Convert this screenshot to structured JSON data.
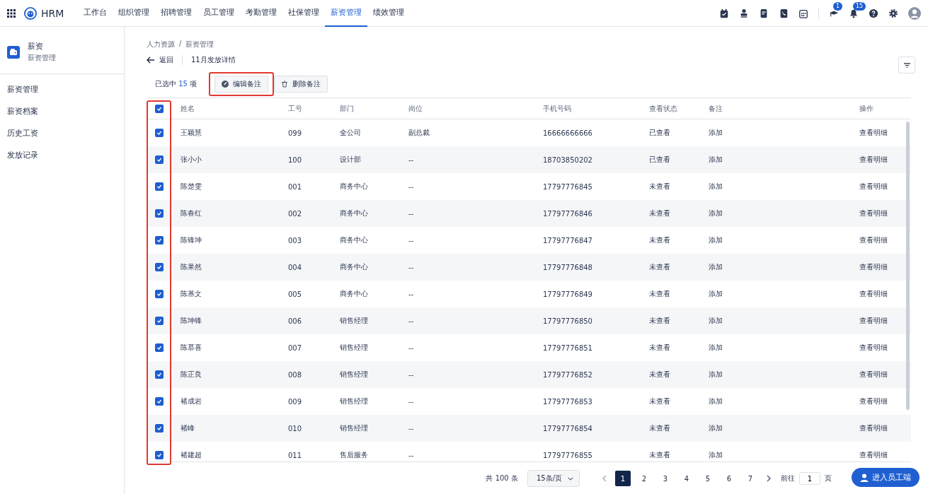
{
  "brand": {
    "name": "HRM"
  },
  "nav": [
    {
      "label": "工作台",
      "selected": false
    },
    {
      "label": "组织管理",
      "selected": false
    },
    {
      "label": "招聘管理",
      "selected": false
    },
    {
      "label": "员工管理",
      "selected": false
    },
    {
      "label": "考勤管理",
      "selected": false
    },
    {
      "label": "社保管理",
      "selected": false
    },
    {
      "label": "薪资管理",
      "selected": true
    },
    {
      "label": "绩效管理",
      "selected": false
    }
  ],
  "toolbar_badges": {
    "flag": "1",
    "bell": "15"
  },
  "sidebar": {
    "title": "薪资",
    "subtitle": "薪资管理",
    "items": [
      {
        "label": "薪资管理",
        "selected": false
      },
      {
        "label": "薪资档案",
        "selected": false
      },
      {
        "label": "历史工资",
        "selected": false
      },
      {
        "label": "发放记录",
        "selected": false
      }
    ]
  },
  "breadcrumb": [
    "人力资源",
    "薪资管理"
  ],
  "breadcrumb_separator": "/",
  "back": "返回",
  "page_title": "11月发放详情",
  "selection": {
    "prefix": "已选中",
    "count": "15",
    "suffix": "项"
  },
  "actions": [
    {
      "label": "编辑备注",
      "kind": "edit",
      "highlighted": true
    },
    {
      "label": "删除备注",
      "kind": "delete",
      "highlighted": false
    }
  ],
  "table": {
    "header_checked": true,
    "checkbox_column_highlighted": true,
    "columns": [
      "姓名",
      "工号",
      "部门",
      "岗位",
      "手机号码",
      "查看状态",
      "备注",
      "操作"
    ],
    "rows": [
      {
        "checked": true,
        "cells": [
          "王颖慧",
          "099",
          "全公司",
          "副总裁",
          "16666666666",
          "已查看",
          "添加",
          "查看明细"
        ]
      },
      {
        "checked": true,
        "cells": [
          "张小小",
          "100",
          "设计部",
          "--",
          "18703850202",
          "已查看",
          "添加",
          "查看明细"
        ]
      },
      {
        "checked": true,
        "cells": [
          "陈楚雯",
          "001",
          "商务中心",
          "--",
          "17797776845",
          "未查看",
          "添加",
          "查看明细"
        ]
      },
      {
        "checked": true,
        "cells": [
          "陈春红",
          "002",
          "商务中心",
          "--",
          "17797776846",
          "未查看",
          "添加",
          "查看明细"
        ]
      },
      {
        "checked": true,
        "cells": [
          "陈锋坤",
          "003",
          "商务中心",
          "--",
          "17797776847",
          "未查看",
          "添加",
          "查看明细"
        ]
      },
      {
        "checked": true,
        "cells": [
          "陈果然",
          "004",
          "商务中心",
          "--",
          "17797776848",
          "未查看",
          "添加",
          "查看明细"
        ]
      },
      {
        "checked": true,
        "cells": [
          "陈基文",
          "005",
          "商务中心",
          "--",
          "17797776849",
          "未查看",
          "添加",
          "查看明细"
        ]
      },
      {
        "checked": true,
        "cells": [
          "陈坤锋",
          "006",
          "销售经理",
          "--",
          "17797776850",
          "未查看",
          "添加",
          "查看明细"
        ]
      },
      {
        "checked": true,
        "cells": [
          "陈慕喜",
          "007",
          "销售经理",
          "--",
          "17797776851",
          "未查看",
          "添加",
          "查看明细"
        ]
      },
      {
        "checked": true,
        "cells": [
          "陈正良",
          "008",
          "销售经理",
          "--",
          "17797776852",
          "未查看",
          "添加",
          "查看明细"
        ]
      },
      {
        "checked": true,
        "cells": [
          "褚成岩",
          "009",
          "销售经理",
          "--",
          "17797776853",
          "未查看",
          "添加",
          "查看明细"
        ]
      },
      {
        "checked": true,
        "cells": [
          "褚峰",
          "010",
          "销售经理",
          "--",
          "17797776854",
          "未查看",
          "添加",
          "查看明细"
        ]
      },
      {
        "checked": true,
        "cells": [
          "褚建超",
          "011",
          "售后服务",
          "--",
          "17797776855",
          "未查看",
          "添加",
          "查看明细"
        ]
      }
    ]
  },
  "pagination": {
    "total": "共 100 条",
    "page_size": "15条/页",
    "pages": [
      {
        "label": "1",
        "selected": true
      },
      {
        "label": "2",
        "selected": false
      },
      {
        "label": "3",
        "selected": false
      },
      {
        "label": "4",
        "selected": false
      },
      {
        "label": "5",
        "selected": false
      },
      {
        "label": "6",
        "selected": false
      },
      {
        "label": "7",
        "selected": false
      }
    ],
    "goto_prefix": "前往",
    "goto_value": "1",
    "goto_suffix": "页"
  },
  "float_button": "进入员工端"
}
